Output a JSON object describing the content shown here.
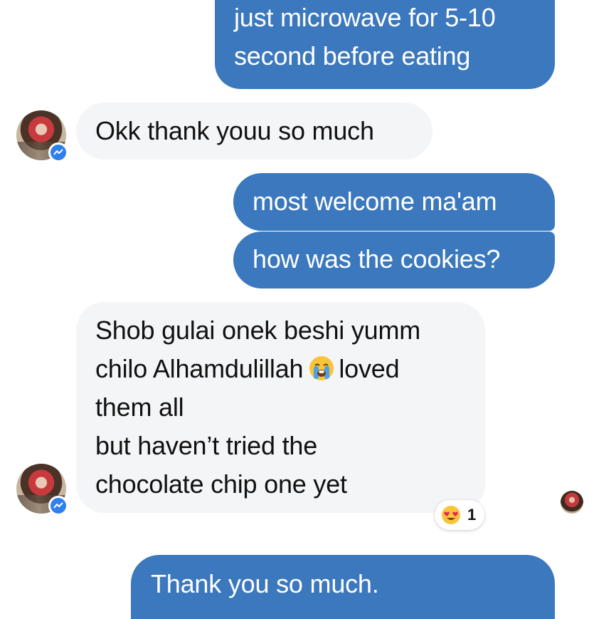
{
  "conversation": {
    "messages": [
      {
        "sender": "me",
        "lines": [
          "just microwave for 5-10",
          "second before eating"
        ]
      },
      {
        "sender": "contact",
        "lines": [
          "Okk thank youu so much"
        ]
      },
      {
        "sender": "me",
        "lines": [
          "most welcome ma'am"
        ]
      },
      {
        "sender": "me",
        "lines": [
          "how was the cookies?"
        ]
      },
      {
        "sender": "contact",
        "lines": [
          "Shob gulai onek beshi yumm",
          "chilo Alhamdulillah",
          "loved",
          "them all",
          "but haven’t tried the",
          "chocolate chip one yet"
        ],
        "inline_emoji": "crying-face-emoji",
        "reaction": {
          "emoji": "heart-eyes-emoji",
          "count": "1"
        }
      },
      {
        "sender": "me",
        "lines": [
          "Thank you so much."
        ]
      }
    ]
  },
  "colors": {
    "outgoing_bubble": "#3c78bd",
    "incoming_bubble": "#f4f5f7",
    "messenger_badge": "#2f80ed"
  }
}
